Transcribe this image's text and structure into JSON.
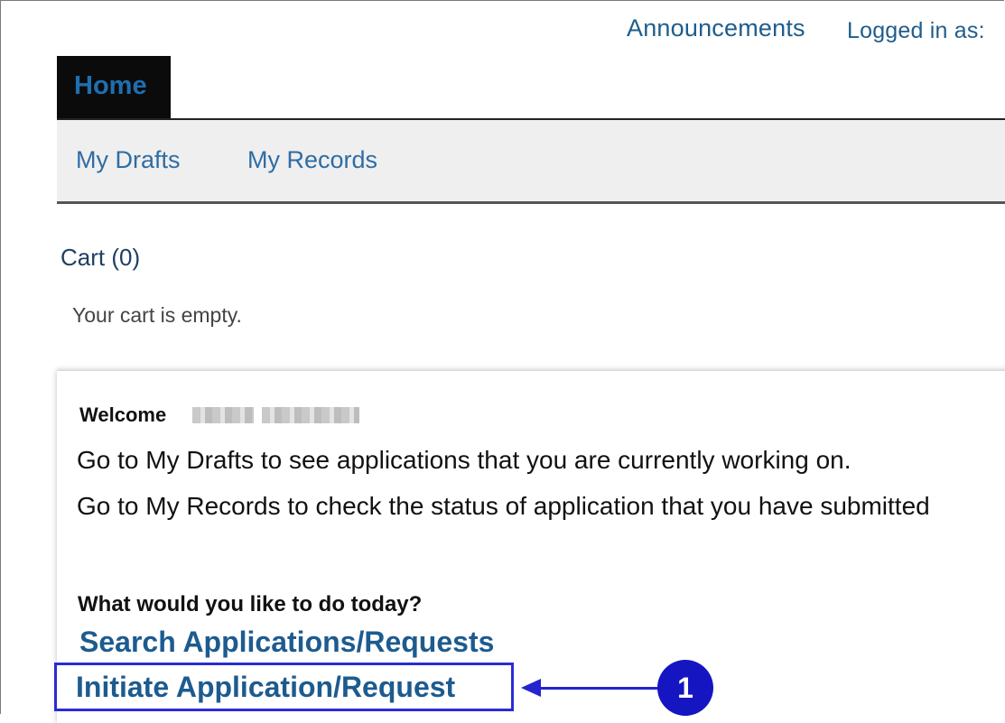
{
  "header": {
    "announcements": "Announcements",
    "logged_in": "Logged in as:"
  },
  "tabs": {
    "home": "Home"
  },
  "subnav": {
    "my_drafts": "My Drafts",
    "my_records": "My Records"
  },
  "cart": {
    "title": "Cart (0)",
    "empty_message": "Your cart is empty."
  },
  "welcome": {
    "label": "Welcome",
    "drafts_text": "Go to My Drafts to see applications that you are currently working on.",
    "records_text": "Go to My Records to check the status of application that you have submitted"
  },
  "actions": {
    "question": "What would you like to do today?",
    "search": "Search Applications/Requests",
    "initiate": "Initiate Application/Request"
  },
  "callout": {
    "number": "1"
  },
  "colors": {
    "link": "#1f5d8c",
    "callout": "#1515c2"
  }
}
